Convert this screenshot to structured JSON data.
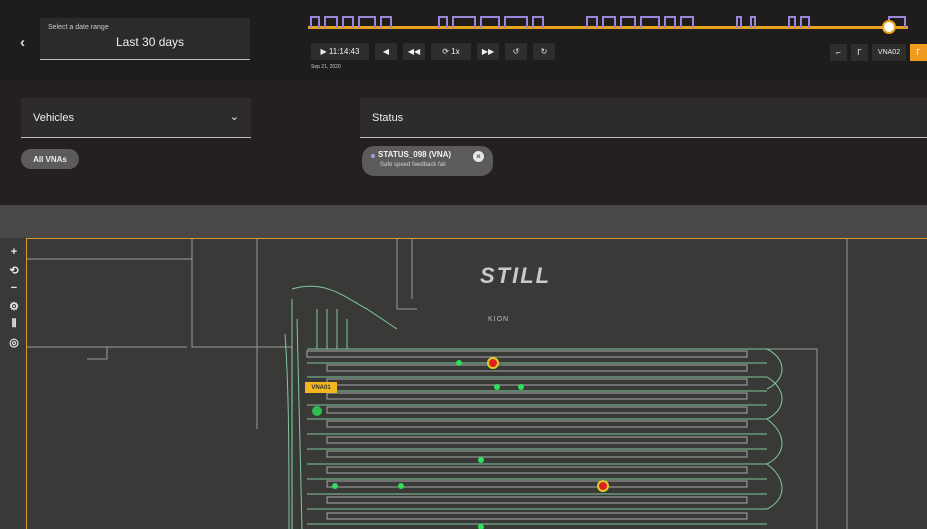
{
  "header": {
    "date_range_label": "Select a date range",
    "date_range_value": "Last 30 days",
    "time": "11:14:43",
    "speed": "1x",
    "date": "Sep 21, 2020",
    "vehicle_id": "VNA02"
  },
  "filters": {
    "vehicles_label": "Vehicles",
    "vehicles_chip": "All VNAs",
    "status_label": "Status",
    "status_chip_title": "STATUS_098 (VNA)",
    "status_chip_subtitle": "Safe speed feedback fail"
  },
  "map": {
    "logo_text": "STILL",
    "logo_sub": "KION",
    "vehicle_tag": "VNA01",
    "tools": [
      "plus-icon",
      "rotate-icon",
      "minus-icon",
      "gear-icon",
      "heatmap-icon",
      "target-icon"
    ]
  },
  "colors": {
    "accent_orange": "#f29a1d",
    "timeline_purple": "#9a86d9",
    "map_path": "#8fe0b0",
    "green_dot": "#2ee05a",
    "red_dot": "#e02020"
  }
}
